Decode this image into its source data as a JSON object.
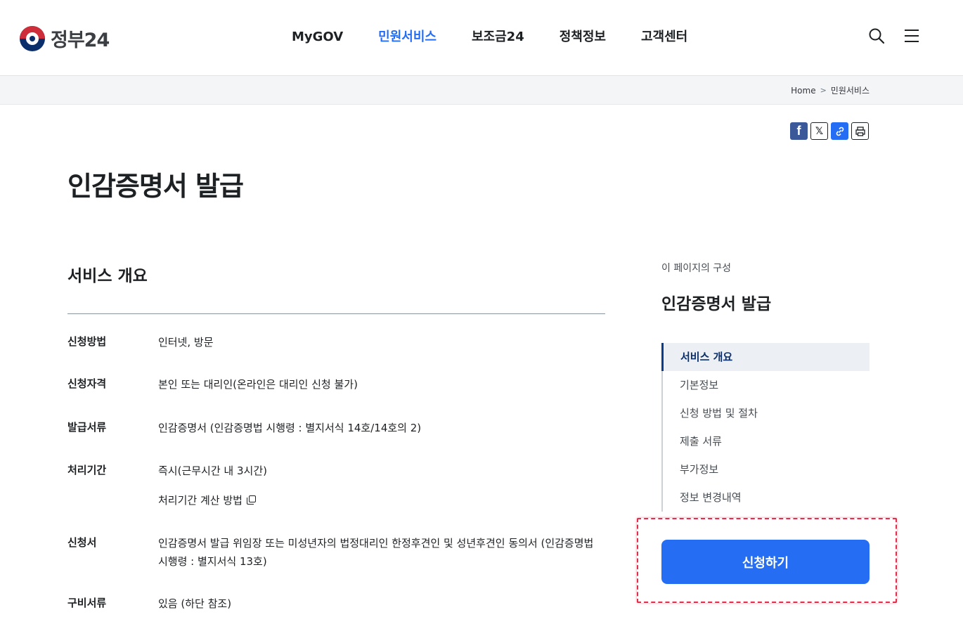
{
  "header": {
    "logo_text": "정부24",
    "nav": [
      "MyGOV",
      "민원서비스",
      "보조금24",
      "정책정보",
      "고객센터"
    ],
    "active_nav": "민원서비스",
    "icons": [
      "search-icon",
      "menu-icon"
    ]
  },
  "breadcrumb": {
    "home": "Home",
    "current": "민원서비스"
  },
  "share": {
    "facebook": "f",
    "x": "𝕏",
    "link": "🔗"
  },
  "page": {
    "title": "인감증명서 발급"
  },
  "overview": {
    "title": "서비스 개요",
    "rows": [
      {
        "label": "신청방법",
        "value": "인터넷, 방문"
      },
      {
        "label": "신청자격",
        "value": "본인 또는 대리인(온라인은 대리인 신청 불가)"
      },
      {
        "label": "발급서류",
        "value": "인감증명서 (인감증명법 시행령 : 별지서식 14호/14호의 2)"
      },
      {
        "label": "처리기간",
        "value": "즉시(근무시간 내 3시간)",
        "sub": "처리기간 계산 방법"
      },
      {
        "label": "신청서",
        "value": "인감증명서 발급 위임장 또는 미성년자의 법정대리인 한정후견인 및 성년후견인 동의서 (인감증명법 시행령 : 별지서식 13호)"
      },
      {
        "label": "구비서류",
        "value": "있음 (하단 참조)"
      }
    ]
  },
  "toc": {
    "caption": "이 페이지의 구성",
    "title": "인감증명서 발급",
    "items": [
      "서비스 개요",
      "기본정보",
      "신청 방법 및 절차",
      "제출 서류",
      "부가정보",
      "정보 변경내역"
    ],
    "active": "서비스 개요"
  },
  "apply_button": "신청하기",
  "colors": {
    "accent": "#256ef4",
    "brand_navy": "#0b2f6b",
    "highlight": "#e0304e"
  }
}
